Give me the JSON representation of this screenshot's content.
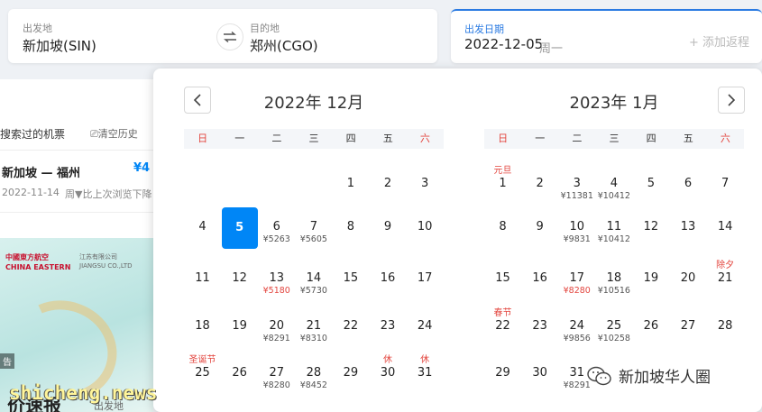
{
  "search": {
    "from_label": "出发地",
    "from_value": "新加坡(SIN)",
    "to_label": "目的地",
    "to_value": "郑州(CGO)",
    "date_label": "出发日期",
    "date_value": "2022-12-05",
    "date_weekday": "周一",
    "add_return": "+ 添加返程",
    "swap_icon": "swap-arrows-icon"
  },
  "history": {
    "title": "搜索过的机票",
    "clear": "⎚清空历史",
    "route": "新加坡 — 福州",
    "price": "¥4",
    "date": "2022-11-14",
    "drop_text": "周▼比上次浏览下降"
  },
  "ad": {
    "airline_cn": "中國東方航空",
    "airline_en": "CHINA EASTERN",
    "partner_cn": "江苏有限公司",
    "partner_en": "JIANGSU CO.,LTD",
    "tag": "告",
    "headline": "价速报",
    "sub": "出发地"
  },
  "calendar": {
    "weekdays": [
      "日",
      "一",
      "二",
      "三",
      "四",
      "五",
      "六"
    ],
    "months": [
      {
        "title": "2022年 12月",
        "first_weekday": 4,
        "days_in_month": 31,
        "selected": 5,
        "days": {
          "6": {
            "price": "¥5263"
          },
          "7": {
            "price": "¥5605"
          },
          "13": {
            "price": "¥5180",
            "low": true
          },
          "14": {
            "price": "¥5730"
          },
          "20": {
            "price": "¥8291"
          },
          "21": {
            "price": "¥8310"
          },
          "25": {
            "holiday": "圣诞节"
          },
          "27": {
            "price": "¥8280"
          },
          "28": {
            "price": "¥8452"
          },
          "30": {
            "holiday": "休"
          },
          "31": {
            "holiday": "休"
          }
        }
      },
      {
        "title": "2023年 1月",
        "first_weekday": 0,
        "days_in_month": 31,
        "selected": null,
        "days": {
          "1": {
            "holiday": "元旦"
          },
          "3": {
            "price": "¥11381"
          },
          "4": {
            "price": "¥10412"
          },
          "10": {
            "price": "¥9831"
          },
          "11": {
            "price": "¥10412"
          },
          "17": {
            "price": "¥8280",
            "low": true
          },
          "18": {
            "price": "¥10516"
          },
          "21": {
            "holiday": "除夕"
          },
          "22": {
            "holiday": "春节"
          },
          "24": {
            "price": "¥9856"
          },
          "25": {
            "price": "¥10258"
          },
          "31": {
            "price": "¥8291"
          }
        }
      }
    ]
  },
  "watermarks": {
    "wechat": "新加坡华人圈",
    "site": "shicheng.news"
  },
  "colors": {
    "accent": "#0086f6",
    "weekend": "#e3463f",
    "date_border": "#2a7ae2"
  }
}
